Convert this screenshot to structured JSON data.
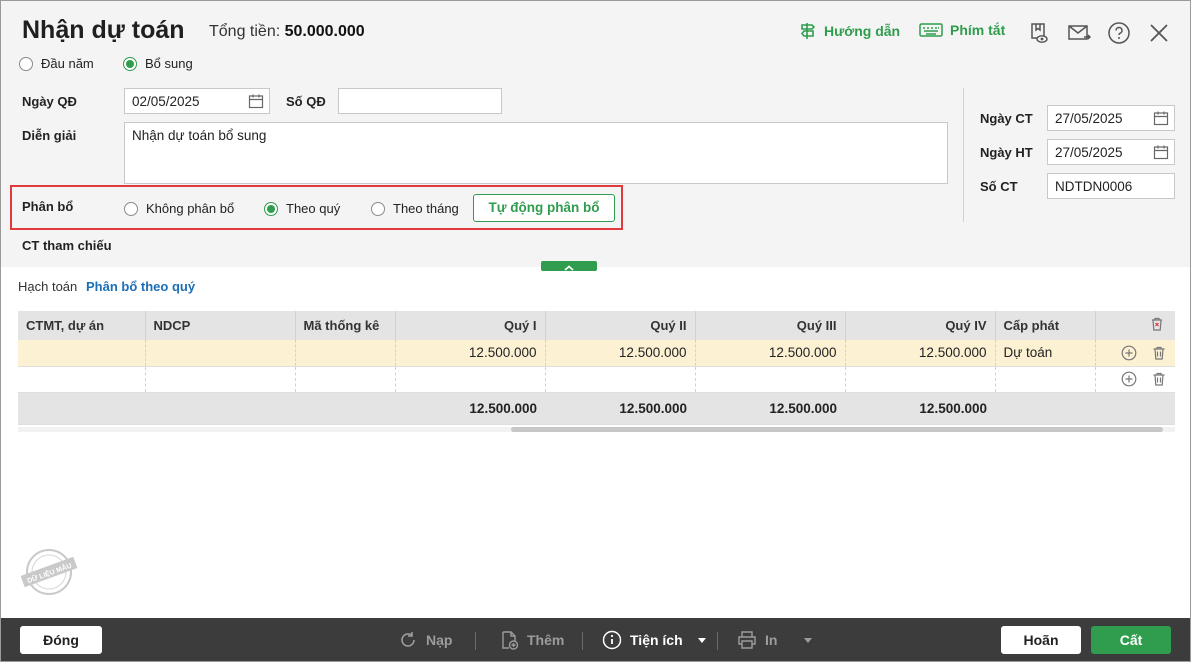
{
  "header": {
    "title": "Nhận dự toán",
    "total_label": "Tổng tiền:",
    "total_value": "50.000.000",
    "guide_label": "Hướng dẫn",
    "shortcut_label": "Phím tắt"
  },
  "type_options": {
    "opt1": "Đầu năm",
    "opt2": "Bổ sung",
    "selected": "Bổ sung"
  },
  "form": {
    "ngay_qd_label": "Ngày QĐ",
    "ngay_qd_value": "02/05/2025",
    "so_qd_label": "Số QĐ",
    "so_qd_value": "",
    "dien_giai_label": "Diễn giải",
    "dien_giai_value": "Nhận dự toán bổ sung",
    "phan_bo_label": "Phân bổ",
    "ct_tham_chieu_label": "CT tham chiếu",
    "ngay_ct_label": "Ngày CT",
    "ngay_ct_value": "27/05/2025",
    "ngay_ht_label": "Ngày HT",
    "ngay_ht_value": "27/05/2025",
    "so_ct_label": "Số CT",
    "so_ct_value": "NDTDN0006"
  },
  "allocation": {
    "opt1": "Không phân bổ",
    "opt2": "Theo quý",
    "opt3": "Theo tháng",
    "selected": "Theo quý",
    "auto_button": "Tự động phân bổ"
  },
  "tabs": {
    "t1": "Hạch toán",
    "t2": "Phân bổ theo quý",
    "active": "Phân bổ theo quý"
  },
  "table": {
    "columns": [
      "CTMT, dự án",
      "NDCP",
      "Mã thống kê",
      "Quý I",
      "Quý II",
      "Quý III",
      "Quý IV",
      "Cấp phát"
    ],
    "rows": [
      {
        "ctmt": "",
        "ndcp": "",
        "ma_thong_ke": "",
        "q1": "12.500.000",
        "q2": "12.500.000",
        "q3": "12.500.000",
        "q4": "12.500.000",
        "cap_phat": "Dự toán"
      },
      {
        "ctmt": "",
        "ndcp": "",
        "ma_thong_ke": "",
        "q1": "",
        "q2": "",
        "q3": "",
        "q4": "",
        "cap_phat": ""
      }
    ],
    "totals": {
      "q1": "12.500.000",
      "q2": "12.500.000",
      "q3": "12.500.000",
      "q4": "12.500.000"
    }
  },
  "stamp_text": "DỮ LIỆU MẪU",
  "footer": {
    "close": "Đóng",
    "reload": "Nạp",
    "add": "Thêm",
    "utilities": "Tiện ích",
    "print": "In",
    "cancel": "Hoãn",
    "save": "Cất"
  },
  "colors": {
    "accent": "#2f9d4d",
    "highlight_row": "#fcf1d3",
    "alert_border": "#e0393e",
    "footer_bg": "#3c3c3c"
  },
  "icons": [
    "guide-icon",
    "keyboard-icon",
    "view-icon",
    "mail-icon",
    "help-icon",
    "close-icon",
    "calendar-icon",
    "chevron-up-icon",
    "delete-all-icon",
    "add-row-icon",
    "delete-row-icon",
    "reload-icon",
    "add-doc-icon",
    "info-icon",
    "caret-down-icon",
    "print-icon"
  ]
}
